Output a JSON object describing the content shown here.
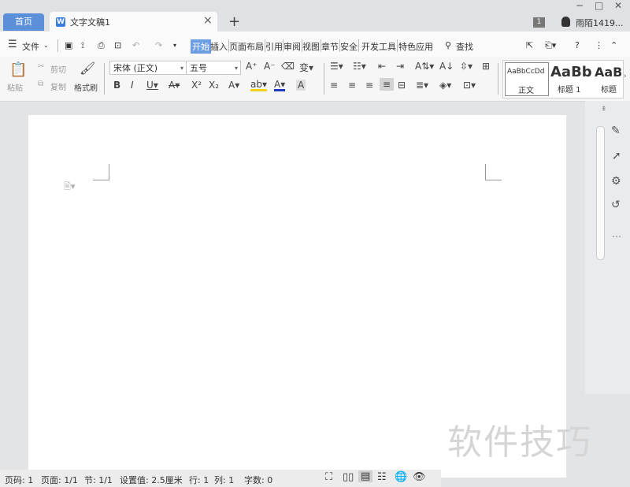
{
  "tabs": {
    "home": "首页",
    "document": "文字文稿1"
  },
  "window": {
    "badge": "1",
    "user": "雨陌1419...",
    "minimize": "−",
    "maximize": "□",
    "close": "✕"
  },
  "menu": {
    "file": "文件",
    "items": [
      "开始",
      "插入",
      "页面布局",
      "引用",
      "审阅",
      "视图",
      "章节",
      "安全",
      "开发工具",
      "特色应用"
    ],
    "find": "查找"
  },
  "ribbon": {
    "paste": "粘贴",
    "cut": "剪切",
    "copy": "复制",
    "format_painter": "格式刷",
    "font_name": "宋体 (正文)",
    "font_size": "五号",
    "style_normal_preview": "AaBbCcDd",
    "style_normal": "正文",
    "style_h1_preview": "AaBb",
    "style_h1": "标题 1",
    "style_h2_preview": "AaB",
    "style_h2": "标题"
  },
  "status": {
    "page_num": "页码: 1",
    "pages": "页面: 1/1",
    "section": "节: 1/1",
    "setting": "设置值: 2.5厘米",
    "row": "行: 1",
    "col": "列: 1",
    "words": "字数: 0"
  },
  "watermark": "软件技巧"
}
